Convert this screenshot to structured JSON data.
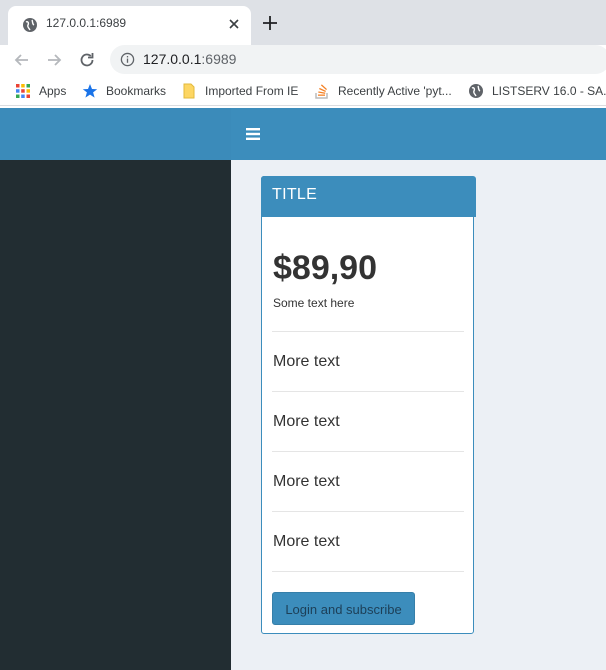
{
  "browser": {
    "tab": {
      "title": "127.0.0.1:6989"
    },
    "address": {
      "host": "127.0.0.1",
      "port": ":6989"
    },
    "bookmarks": [
      {
        "label": "Apps",
        "icon": "apps-grid-icon"
      },
      {
        "label": "Bookmarks",
        "icon": "star-icon"
      },
      {
        "label": "Imported From IE",
        "icon": "folder-icon"
      },
      {
        "label": "Recently Active 'pyt...",
        "icon": "stack-icon"
      },
      {
        "label": "LISTSERV 16.0 - SA...",
        "icon": "globe-icon"
      }
    ]
  },
  "app": {
    "colors": {
      "primary": "#3c8dbc",
      "sidebar": "#222d32",
      "content_bg": "#ecf0f5"
    },
    "card": {
      "title": "TITLE",
      "price": "$89,90",
      "subtext": "Some text here",
      "items": [
        "More text",
        "More text",
        "More text",
        "More text"
      ],
      "button_label": "Login and subscribe"
    }
  }
}
